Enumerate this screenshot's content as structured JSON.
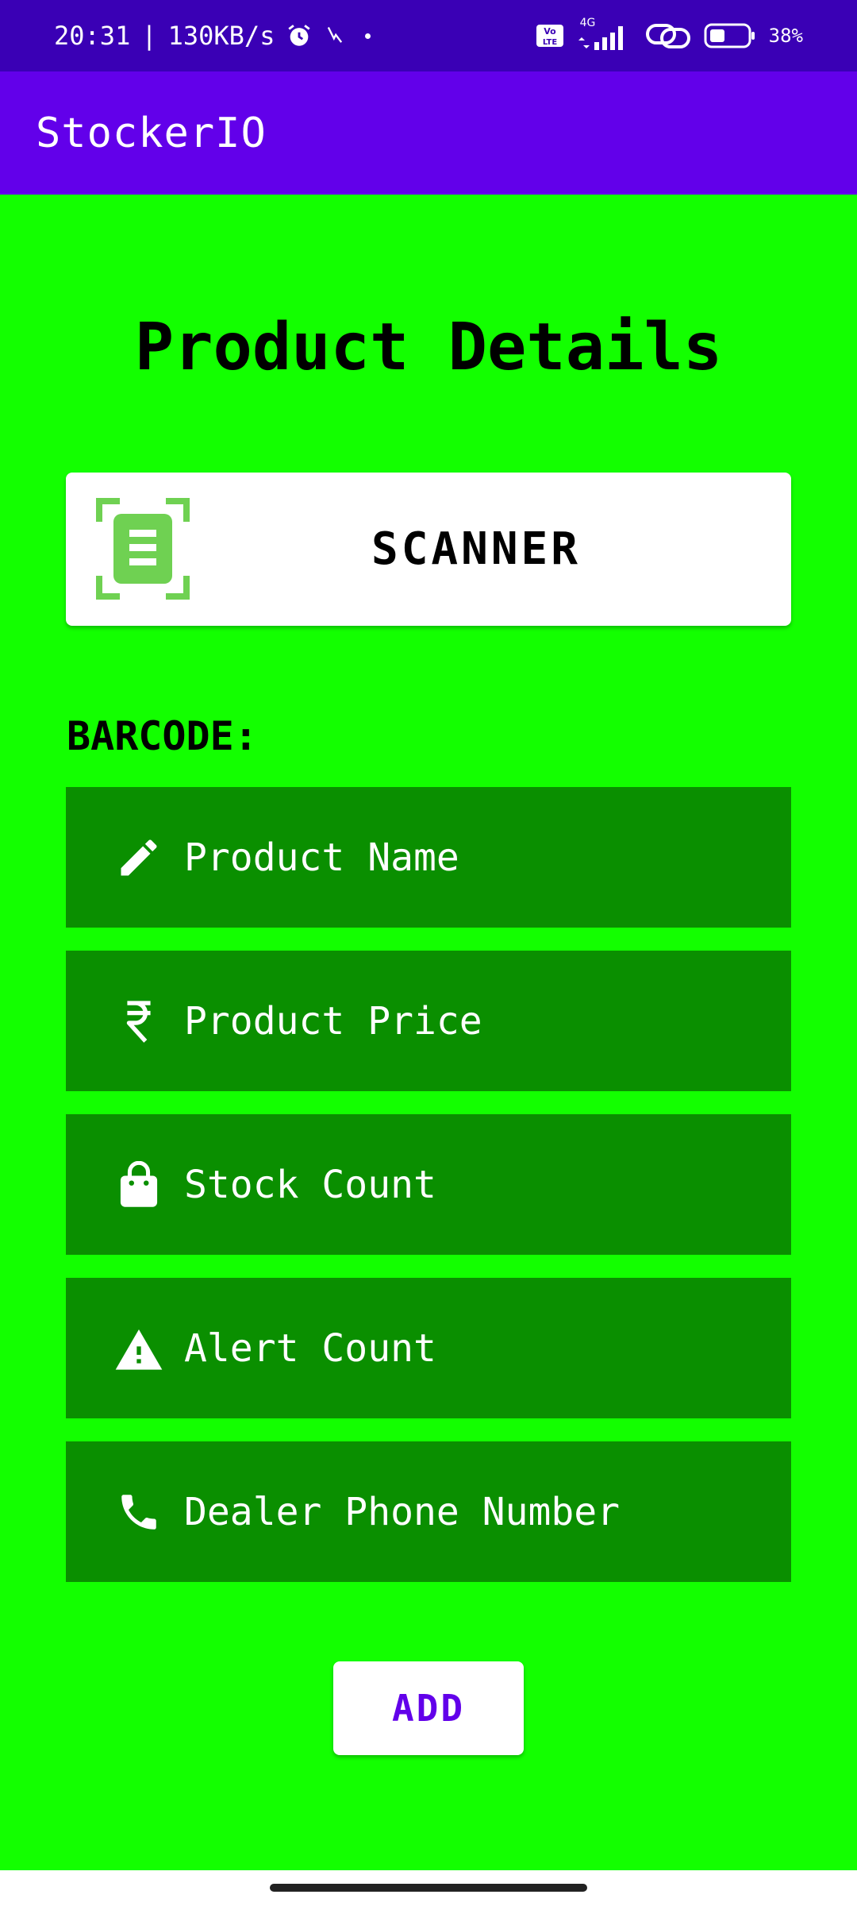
{
  "status_bar": {
    "time": "20:31",
    "separator": "|",
    "net_speed": "130KB/s",
    "network_label": "4G",
    "battery_percent": "38%",
    "icons": [
      "alarm-icon",
      "volte-icon",
      "signal-icon",
      "link-icon",
      "battery-icon"
    ]
  },
  "app_bar": {
    "title": "StockerIO",
    "color": "#6200ea"
  },
  "page": {
    "title": "Product Details",
    "background": "#13ff00"
  },
  "scanner": {
    "label": "SCANNER",
    "icon": "scanner-icon"
  },
  "barcode": {
    "label": "BARCODE:"
  },
  "fields": [
    {
      "icon": "pencil-icon",
      "placeholder": "Product Name"
    },
    {
      "icon": "rupee-icon",
      "placeholder": "Product Price"
    },
    {
      "icon": "shopping-bag-icon",
      "placeholder": "Stock Count"
    },
    {
      "icon": "warning-icon",
      "placeholder": "Alert Count"
    },
    {
      "icon": "phone-icon",
      "placeholder": "Dealer Phone Number"
    }
  ],
  "add_button": {
    "label": "ADD",
    "color": "#6200ea"
  }
}
